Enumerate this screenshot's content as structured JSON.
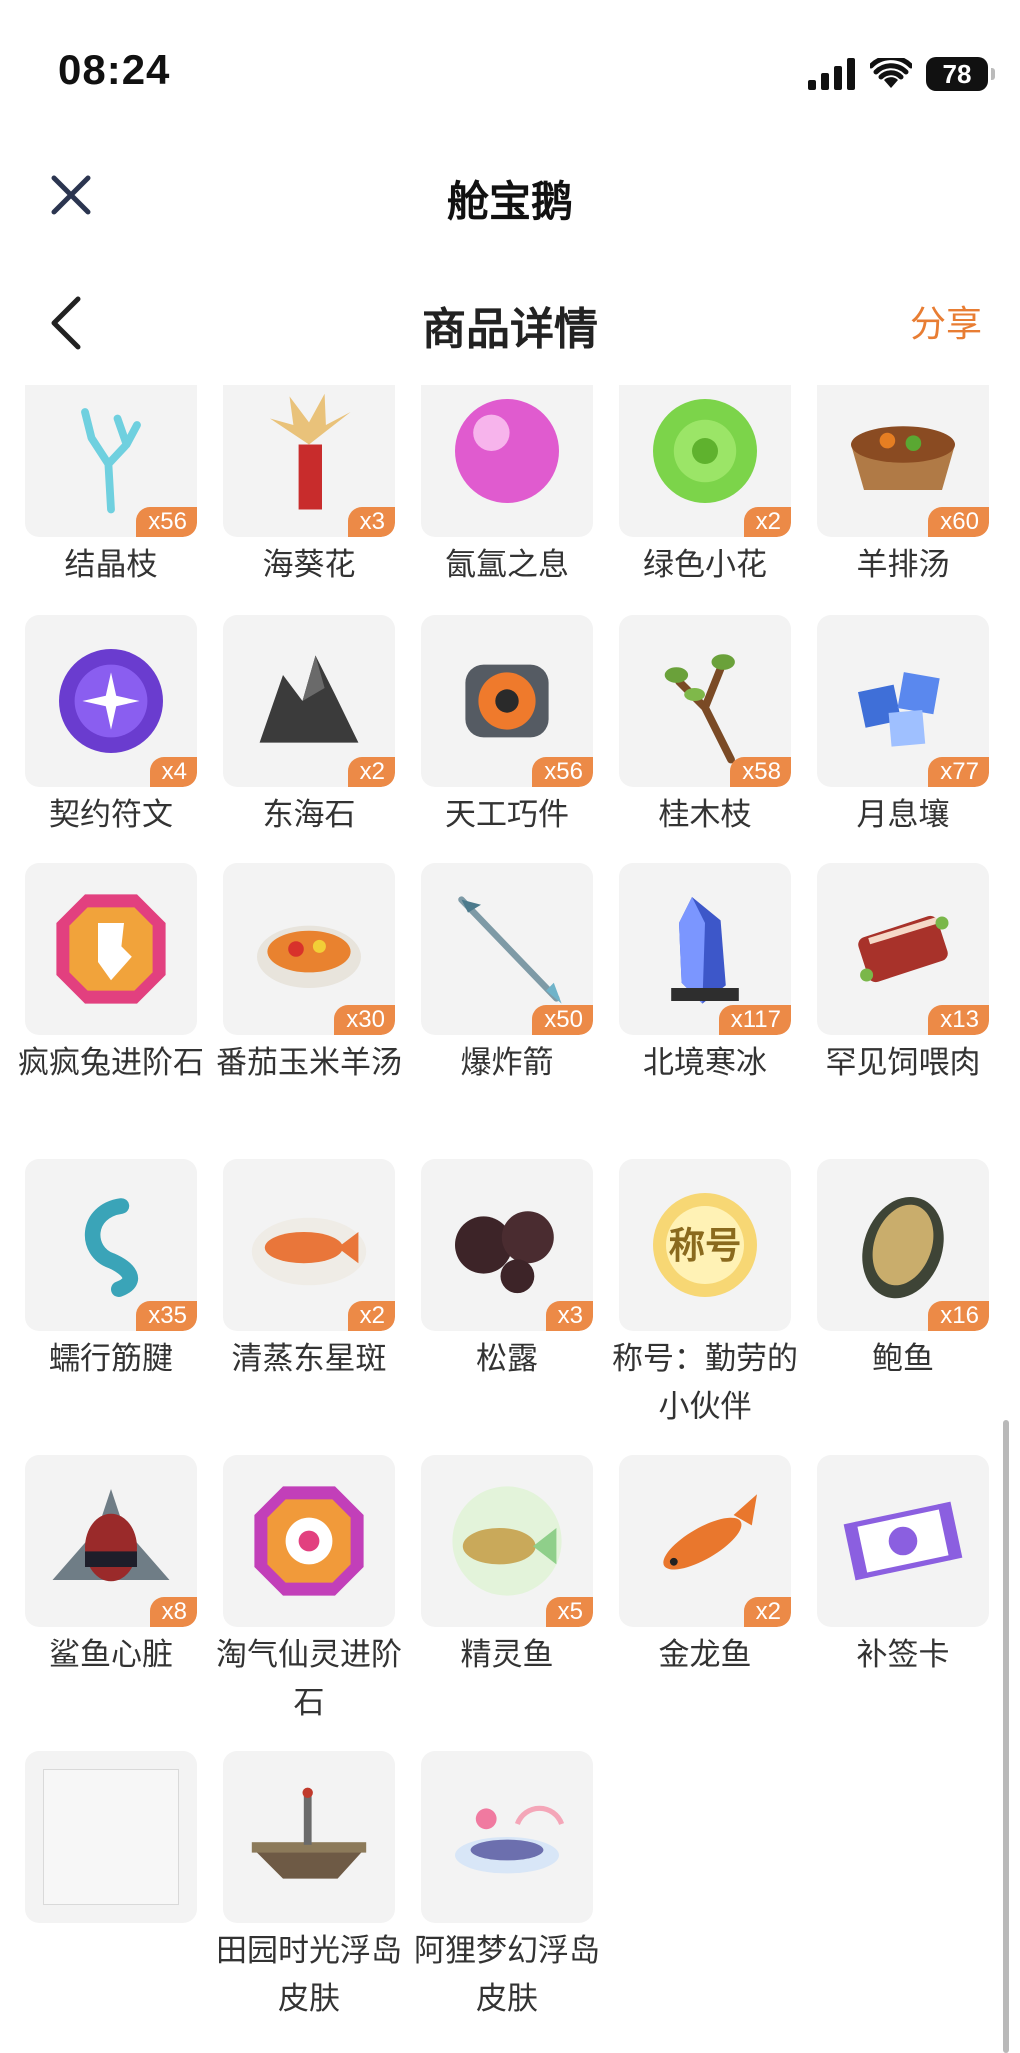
{
  "status_bar": {
    "time": "08:24",
    "battery": "78"
  },
  "mini_header": {
    "title": "舱宝鹅"
  },
  "nav": {
    "title": "商品详情",
    "share": "分享"
  },
  "colors": {
    "accent": "#e87d33",
    "badge": "#ec8a47",
    "tile": "#f3f3f3"
  },
  "rows": [
    {
      "items": [
        {
          "name": "结晶枝",
          "count": "x56",
          "icon": "crystal-branch-icon"
        },
        {
          "name": "海葵花",
          "count": "x3",
          "icon": "anemone-flower-icon"
        },
        {
          "name": "氤氲之息",
          "count": "",
          "icon": "pink-orb-icon"
        },
        {
          "name": "绿色小花",
          "count": "x2",
          "icon": "green-flower-icon"
        },
        {
          "name": "羊排汤",
          "count": "x60",
          "icon": "soup-bowl-icon"
        }
      ]
    },
    {
      "items": [
        {
          "name": "契约符文",
          "count": "x4",
          "icon": "rune-icon"
        },
        {
          "name": "东海石",
          "count": "x2",
          "icon": "dark-stone-icon"
        },
        {
          "name": "天工巧件",
          "count": "x56",
          "icon": "gear-part-icon"
        },
        {
          "name": "桂木枝",
          "count": "x58",
          "icon": "twig-icon"
        },
        {
          "name": "月息壤",
          "count": "x77",
          "icon": "blue-cubes-icon"
        }
      ]
    },
    {
      "items": [
        {
          "name": "疯疯兔进阶石",
          "count": "",
          "icon": "rabbit-gem-icon"
        },
        {
          "name": "番茄玉米羊汤",
          "count": "x30",
          "icon": "tomato-soup-icon"
        },
        {
          "name": "爆炸箭",
          "count": "x50",
          "icon": "arrow-icon"
        },
        {
          "name": "北境寒冰",
          "count": "x117",
          "icon": "ice-crystal-icon"
        },
        {
          "name": "罕见饲喂肉",
          "count": "x13",
          "icon": "meat-icon"
        }
      ]
    },
    {
      "items": [
        {
          "name": "蠕行筋腱",
          "count": "x35",
          "icon": "tendon-icon"
        },
        {
          "name": "清蒸东星斑",
          "count": "x2",
          "icon": "steamed-fish-icon"
        },
        {
          "name": "松露",
          "count": "x3",
          "icon": "truffle-icon"
        },
        {
          "name": "称号：勤劳的小伙伴",
          "count": "",
          "icon": "title-badge-icon",
          "badge_text": "称号"
        },
        {
          "name": "鲍鱼",
          "count": "x16",
          "icon": "abalone-icon"
        }
      ]
    },
    {
      "items": [
        {
          "name": "鲨鱼心脏",
          "count": "x8",
          "icon": "shark-heart-icon"
        },
        {
          "name": "淘气仙灵进阶石",
          "count": "",
          "icon": "fairy-gem-icon"
        },
        {
          "name": "精灵鱼",
          "count": "x5",
          "icon": "spirit-fish-icon"
        },
        {
          "name": "金龙鱼",
          "count": "x2",
          "icon": "arowana-icon"
        },
        {
          "name": "补签卡",
          "count": "",
          "icon": "ticket-card-icon"
        }
      ]
    },
    {
      "items": [
        {
          "name": "",
          "count": "",
          "icon": "blank-placeholder-icon"
        },
        {
          "name": "田园时光浮岛皮肤",
          "count": "",
          "icon": "floating-island-icon"
        },
        {
          "name": "阿狸梦幻浮岛皮肤",
          "count": "",
          "icon": "dream-island-icon"
        }
      ]
    }
  ]
}
